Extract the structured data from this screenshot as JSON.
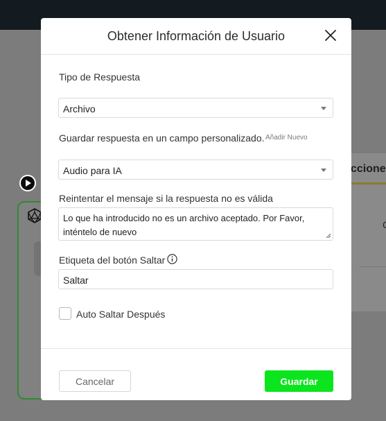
{
  "background": {
    "side_tab_label": "cciones",
    "side_letter": "C"
  },
  "modal": {
    "title": "Obtener Información de Usuario",
    "response_type": {
      "label": "Tipo de Respuesta",
      "selected": "Archivo"
    },
    "custom_field": {
      "label": "Guardar respuesta en un campo personalizado.",
      "add_new_label": "Añadir Nuevo",
      "selected": "Audio para IA"
    },
    "retry": {
      "label": "Reintentar el mensaje si la respuesta no es válida",
      "value": "Lo que ha introducido no es un archivo aceptado. Por Favor, inténtelo de nuevo"
    },
    "skip_button": {
      "label": "Etiqueta del botón Saltar",
      "value": "Saltar"
    },
    "auto_skip": {
      "label": "Auto Saltar Después",
      "checked": false
    },
    "buttons": {
      "cancel": "Cancelar",
      "save": "Guardar"
    }
  },
  "colors": {
    "save_button": "#0be51d",
    "flow_border": "#2e8a2e",
    "topbar": "#141b20"
  }
}
